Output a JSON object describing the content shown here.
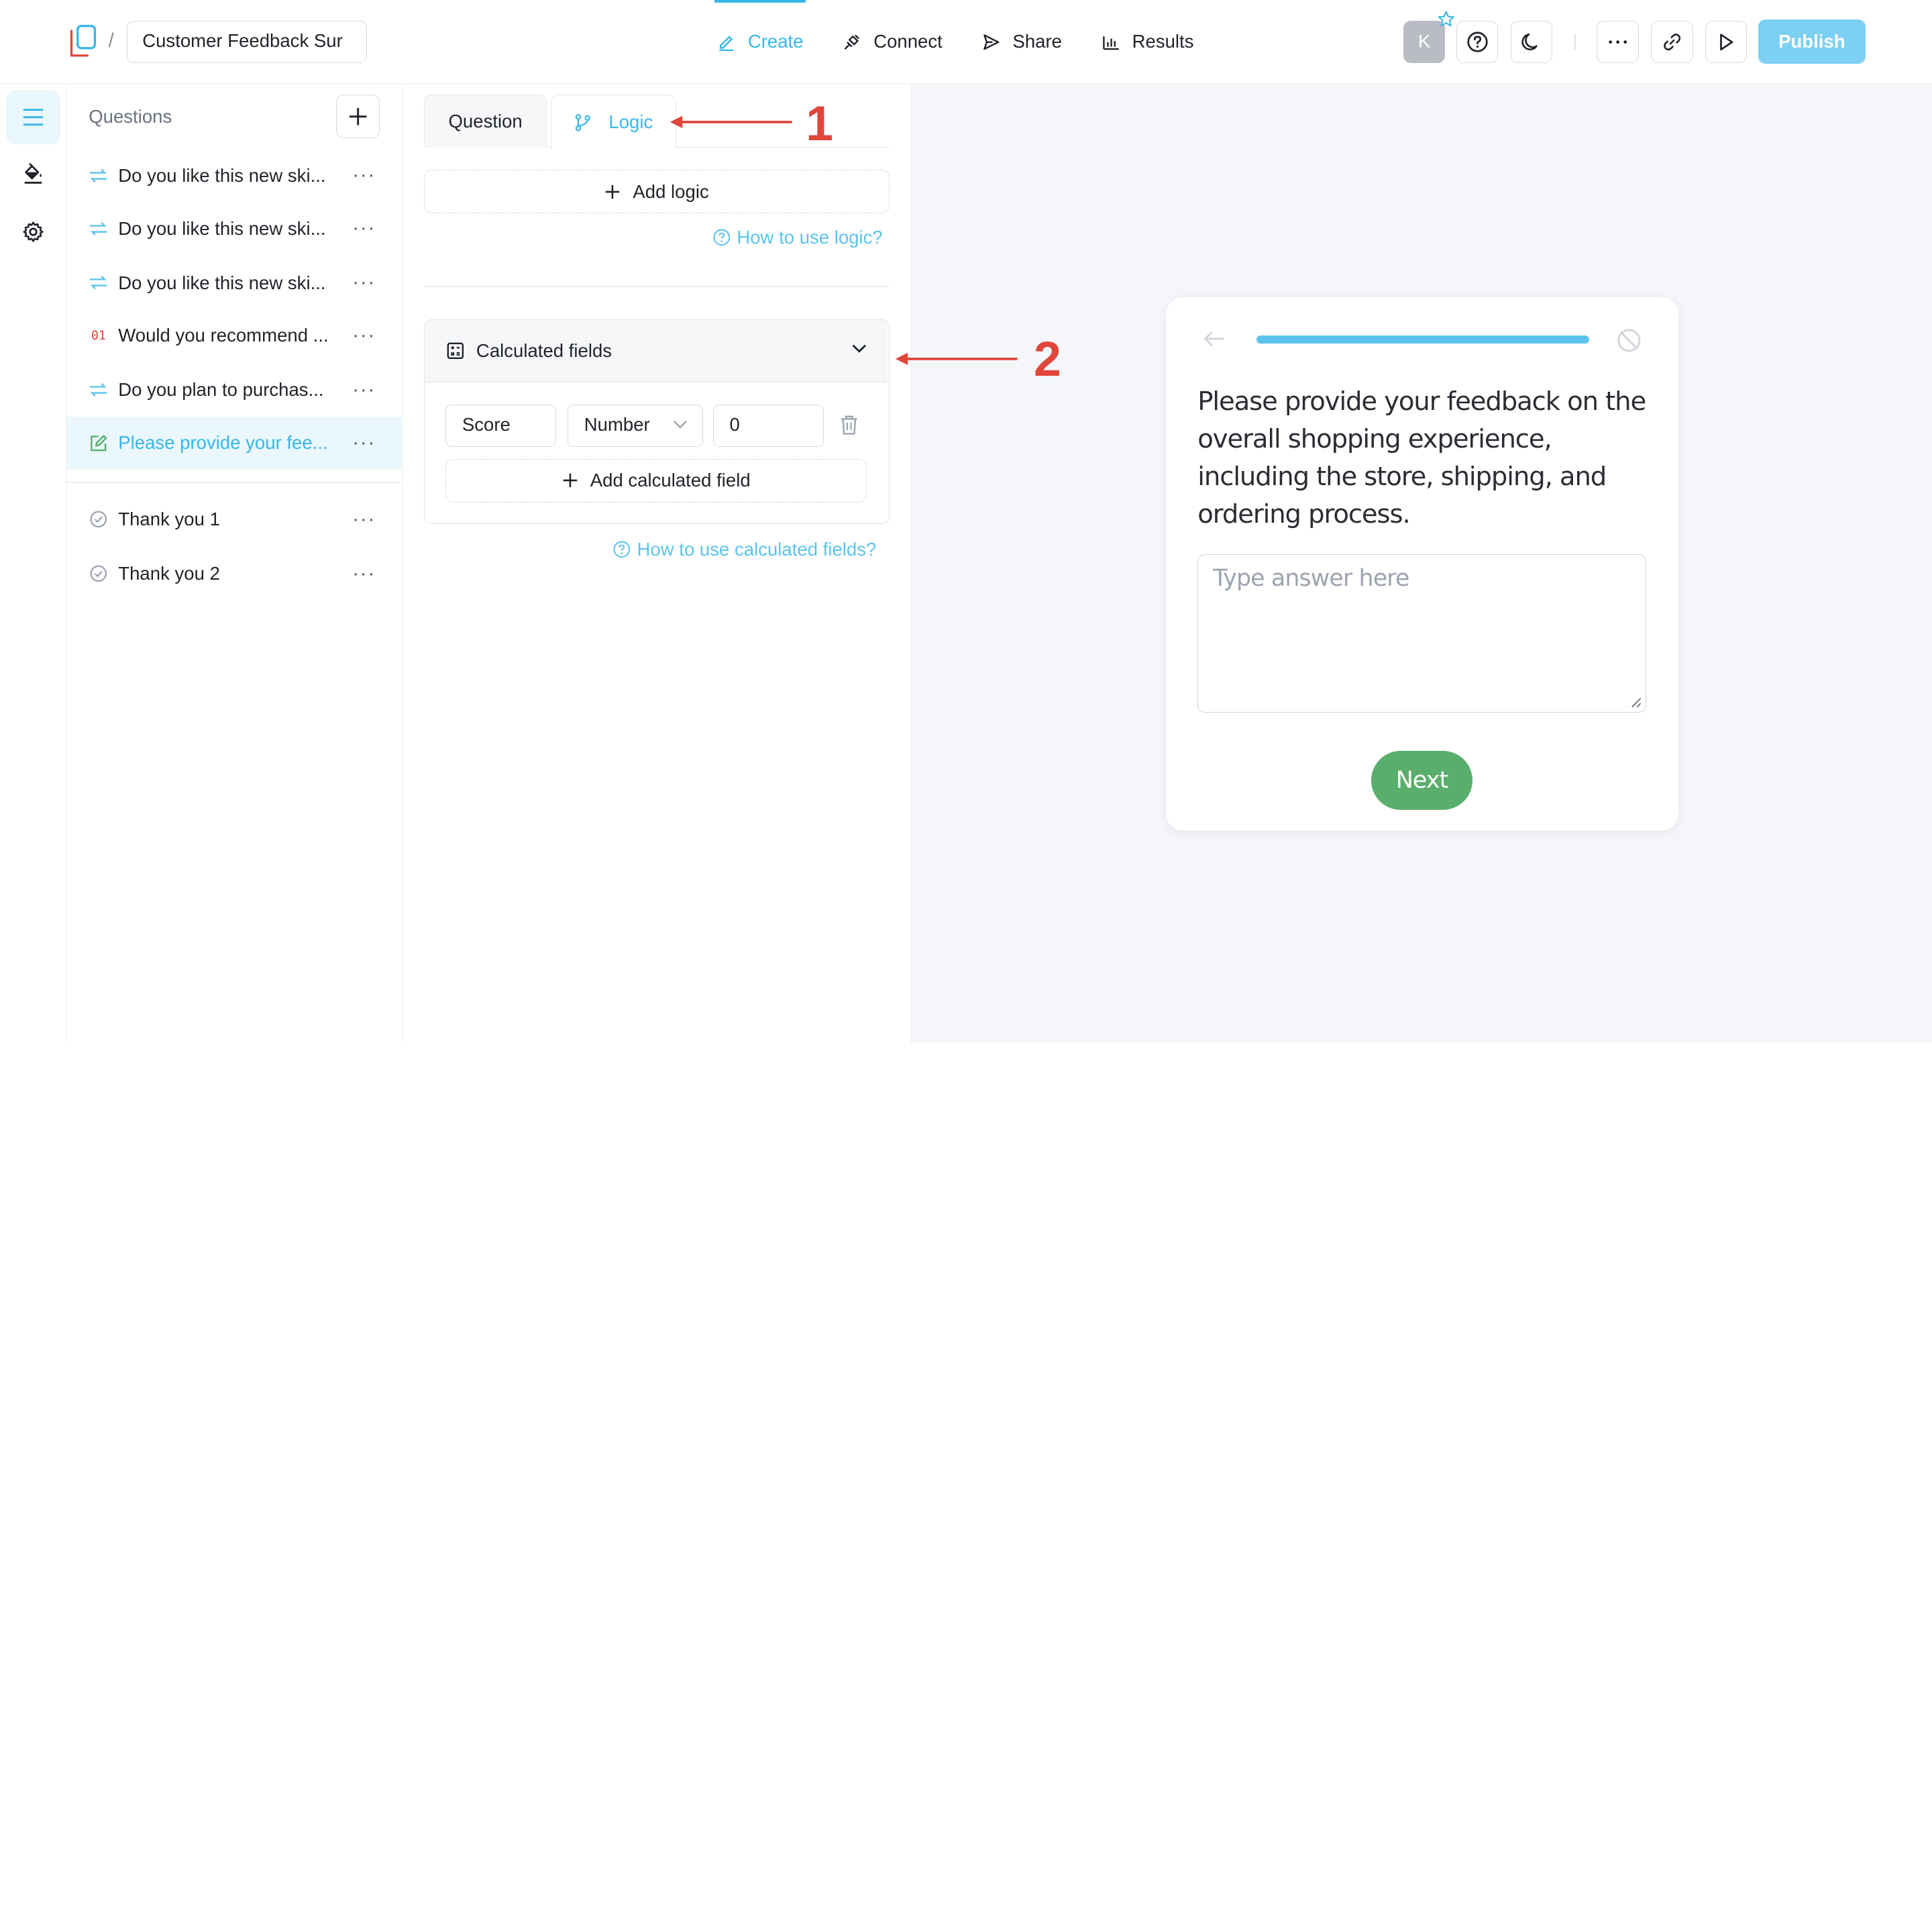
{
  "header": {
    "breadcrumb_separator": "/",
    "survey_title": "Customer Feedback Sur",
    "nav": [
      {
        "label": "Create",
        "icon": "pencil-icon",
        "active": true
      },
      {
        "label": "Connect",
        "icon": "plug-icon",
        "active": false
      },
      {
        "label": "Share",
        "icon": "send-icon",
        "active": false
      },
      {
        "label": "Results",
        "icon": "bar-chart-icon",
        "active": false
      }
    ],
    "avatar_letter": "K",
    "publish_label": "Publish"
  },
  "questions_panel": {
    "title": "Questions",
    "items": [
      {
        "label": "Do you like this new ski...",
        "icon": "yes-no-icon",
        "active": false
      },
      {
        "label": "Do you like this new ski...",
        "icon": "yes-no-icon",
        "active": false
      },
      {
        "label": "Do you like this new ski...",
        "icon": "yes-no-icon",
        "active": false
      },
      {
        "label": "Would you recommend ...",
        "icon": "opinion-scale-icon",
        "active": false,
        "icon_text": "01"
      },
      {
        "label": "Do you plan to purchas...",
        "icon": "yes-no-icon",
        "active": false
      },
      {
        "label": "Please provide your fee...",
        "icon": "long-text-icon",
        "active": true
      }
    ],
    "endings": [
      {
        "label": "Thank you 1",
        "icon": "check-circle-icon"
      },
      {
        "label": "Thank you 2",
        "icon": "check-circle-icon"
      }
    ],
    "more_label": "···"
  },
  "logic_panel": {
    "tabs": {
      "question": "Question",
      "logic": "Logic"
    },
    "add_logic_label": "Add logic",
    "help_logic": "How to use logic?",
    "calc_title": "Calculated fields",
    "field": {
      "name": "Score",
      "type": "Number",
      "value": "0"
    },
    "add_calc_label": "Add calculated field",
    "help_calc": "How to use calculated fields?"
  },
  "preview": {
    "progress": 1.0,
    "question": "Please provide your feedback on the overall shopping experience, including the store, shipping, and ordering process.",
    "answer_placeholder": "Type answer here",
    "next_label": "Next"
  },
  "annotations": {
    "one": "1",
    "two": "2",
    "color": "#e0463a"
  },
  "colors": {
    "accent": "#38b6e8",
    "publish": "#7cd0f2",
    "next": "#5aae6c"
  }
}
